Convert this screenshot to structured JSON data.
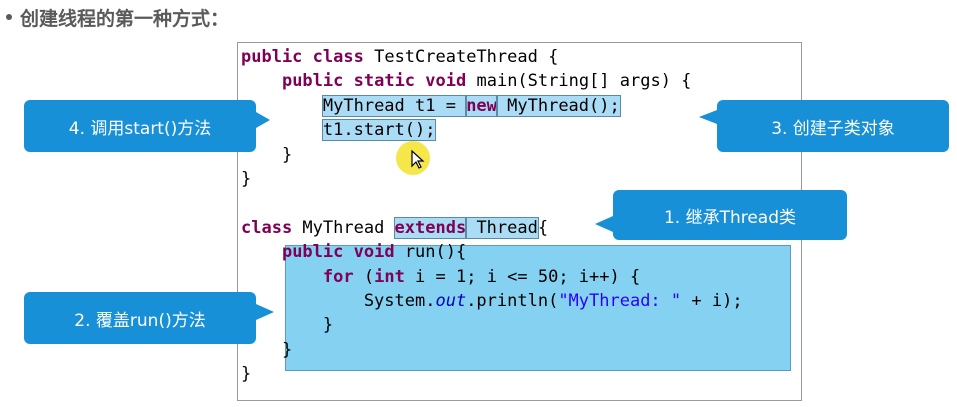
{
  "heading": {
    "text": "创建线程的第一种方式："
  },
  "code": {
    "lines": [
      {
        "tokens": [
          {
            "t": "public",
            "c": "kw"
          },
          {
            "t": " "
          },
          {
            "t": "class",
            "c": "kw"
          },
          {
            "t": " TestCreateThread {"
          }
        ]
      },
      {
        "tokens": [
          {
            "t": "    "
          },
          {
            "t": "public",
            "c": "kw"
          },
          {
            "t": " "
          },
          {
            "t": "static",
            "c": "kw"
          },
          {
            "t": " "
          },
          {
            "t": "void",
            "c": "kw"
          },
          {
            "t": " main(String[] args) {"
          }
        ]
      },
      {
        "tokens": [
          {
            "t": "        "
          },
          {
            "t": "MyThread t1 = ",
            "h": true
          },
          {
            "t": "new",
            "c": "kw",
            "h": true
          },
          {
            "t": " MyThread();",
            "h": true
          }
        ]
      },
      {
        "tokens": [
          {
            "t": "        "
          },
          {
            "t": "t1.start();",
            "h": true
          }
        ]
      },
      {
        "tokens": [
          {
            "t": "    }"
          }
        ]
      },
      {
        "tokens": [
          {
            "t": "}"
          }
        ]
      },
      {
        "tokens": [
          {
            "t": ""
          }
        ]
      },
      {
        "tokens": [
          {
            "t": "class",
            "c": "kw"
          },
          {
            "t": " MyThread "
          },
          {
            "t": "extends",
            "c": "kw",
            "h": true
          },
          {
            "t": " Thread",
            "h": true
          },
          {
            "t": "{"
          }
        ]
      },
      {
        "tokens": [
          {
            "t": "    "
          },
          {
            "t": "public",
            "c": "kw"
          },
          {
            "t": " "
          },
          {
            "t": "void",
            "c": "kw"
          },
          {
            "t": " run(){"
          }
        ]
      },
      {
        "tokens": [
          {
            "t": "        "
          },
          {
            "t": "for",
            "c": "kw"
          },
          {
            "t": " ("
          },
          {
            "t": "int",
            "c": "kw"
          },
          {
            "t": " i = 1; i <= 50; i++) {"
          }
        ]
      },
      {
        "tokens": [
          {
            "t": "            System."
          },
          {
            "t": "out",
            "c": "fld"
          },
          {
            "t": ".println("
          },
          {
            "t": "\"MyThread: \"",
            "c": "str"
          },
          {
            "t": " + i);"
          }
        ]
      },
      {
        "tokens": [
          {
            "t": "        }"
          }
        ]
      },
      {
        "tokens": [
          {
            "t": "    }"
          }
        ]
      },
      {
        "tokens": [
          {
            "t": "}"
          }
        ]
      }
    ]
  },
  "callouts": {
    "c1": {
      "label": "1. 继承Thread类"
    },
    "c2": {
      "label": "2. 覆盖run()方法"
    },
    "c3": {
      "label": "3. 创建子类对象"
    },
    "c4": {
      "label": "4. 调用start()方法"
    }
  },
  "colors": {
    "callout": "#1790d8",
    "highlight": "#aadcf5",
    "block_highlight": "#6fc9ef",
    "keyword": "#7f0055"
  },
  "icons": {
    "cursor": "pointer-arrow-icon"
  }
}
